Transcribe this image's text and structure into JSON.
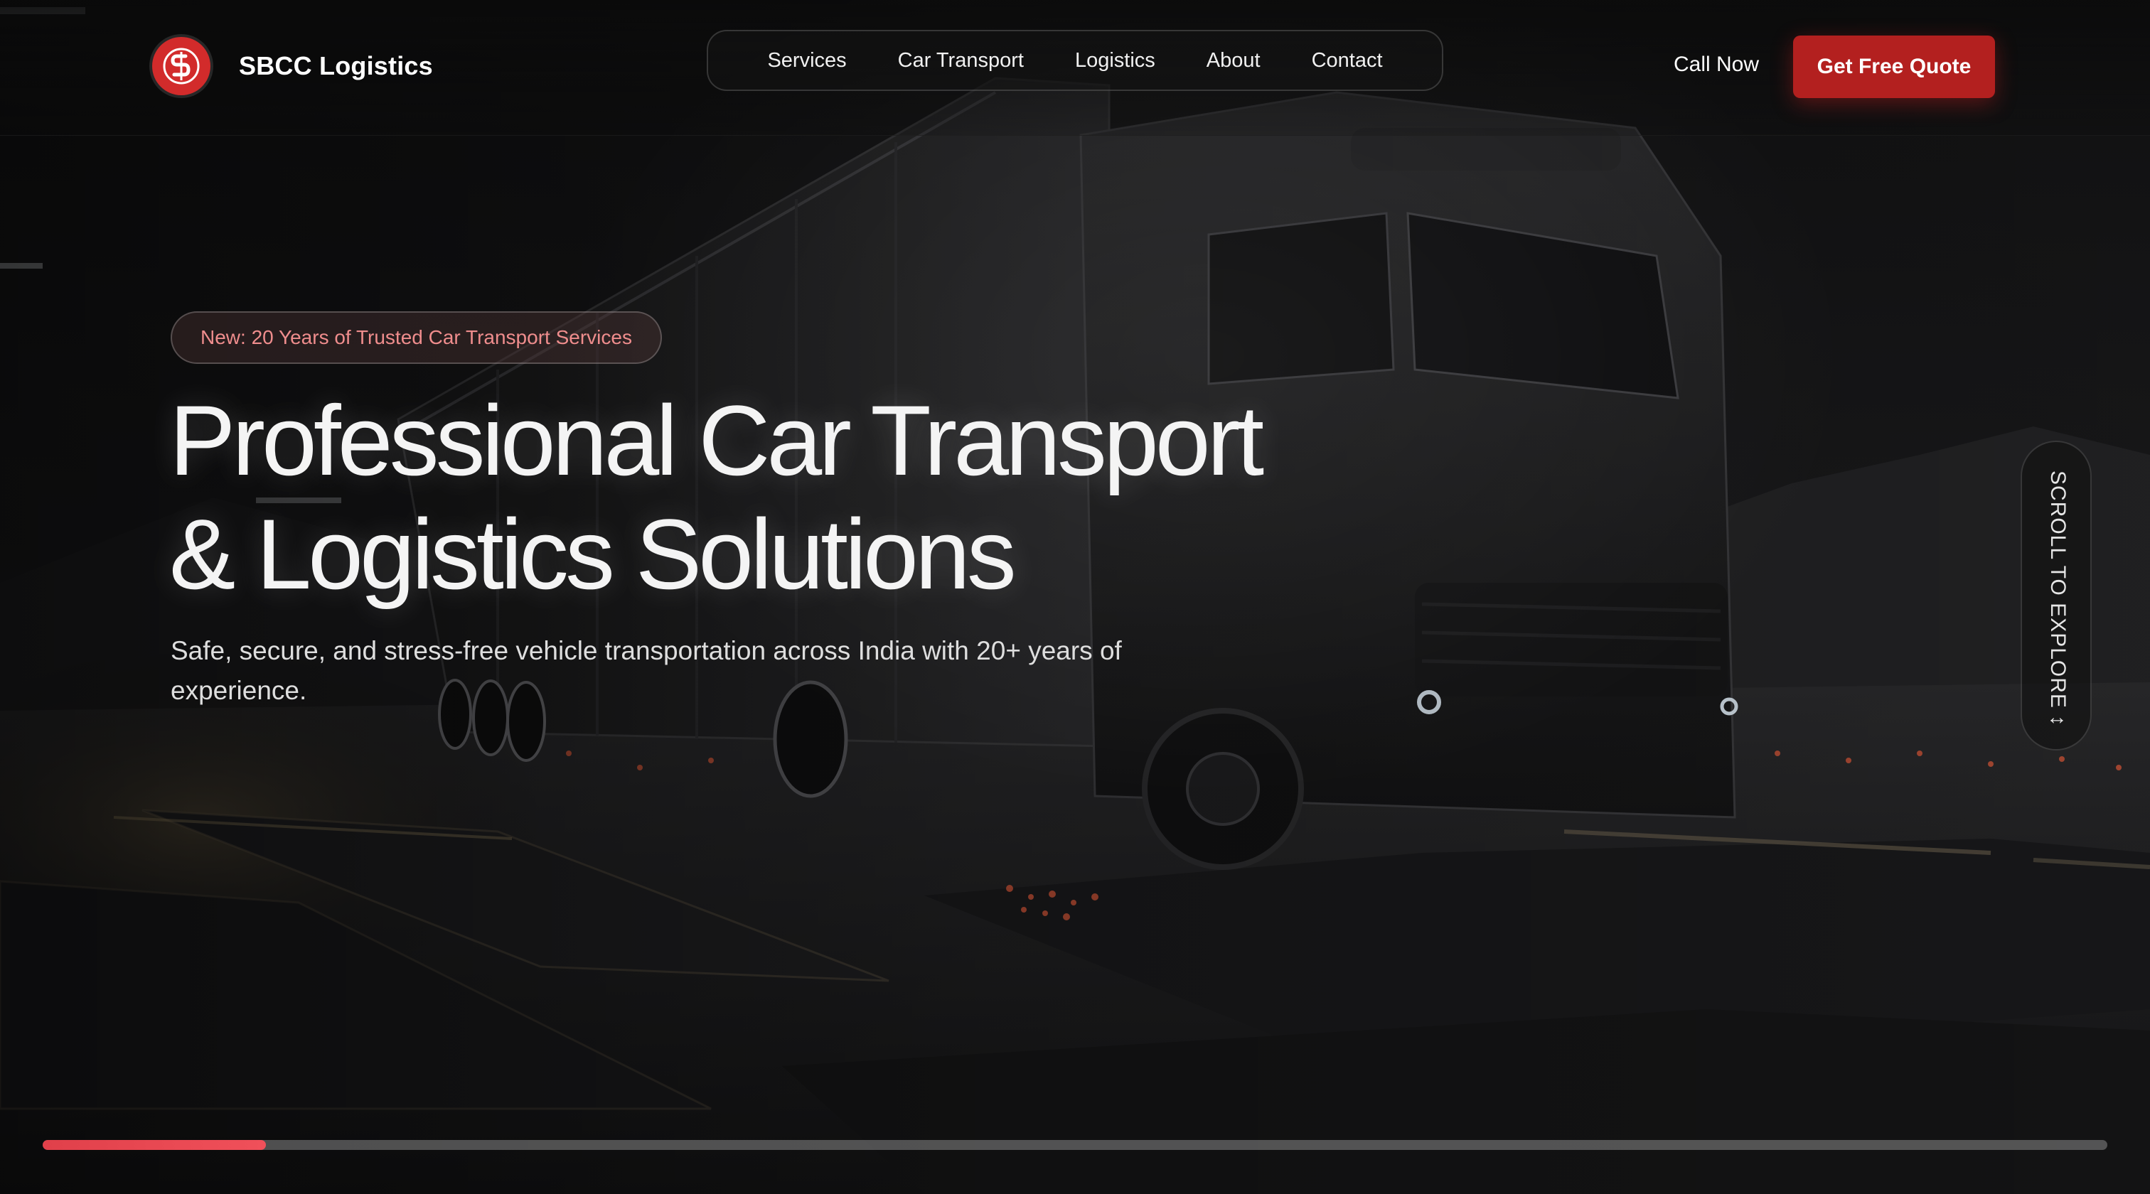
{
  "brand": {
    "name": "SBCC Logistics",
    "logo_icon": "sbcc-monogram-logo",
    "accent_color": "#d22b2b"
  },
  "nav": {
    "items": [
      {
        "label": "Services"
      },
      {
        "label": "Car Transport"
      },
      {
        "label": "Logistics"
      },
      {
        "label": "About"
      },
      {
        "label": "Contact"
      }
    ]
  },
  "header_actions": {
    "call_label": "Call Now",
    "quote_label": "Get Free Quote",
    "quote_color": "#b3201f"
  },
  "hero": {
    "badge": "New: 20 Years of Trusted Car Transport Services",
    "title_line1": "Professional Car Transport",
    "title_line2": "& Logistics Solutions",
    "subtitle": "Safe, secure, and stress-free vehicle transportation across India with 20+ years of experience."
  },
  "scroll_hint": {
    "label": "SCROLL TO EXPLORE ↕"
  },
  "progress": {
    "value_percent": 10.8,
    "color": "#e0404a"
  }
}
